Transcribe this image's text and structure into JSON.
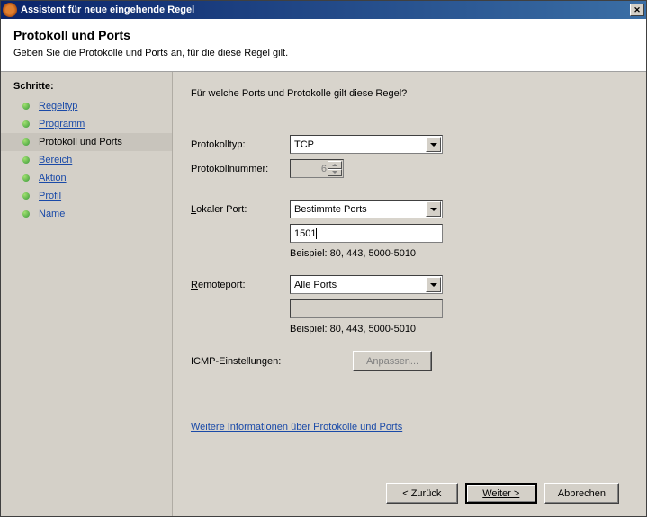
{
  "window": {
    "title": "Assistent für neue eingehende Regel"
  },
  "header": {
    "title": "Protokoll und Ports",
    "subtitle": "Geben Sie die Protokolle und Ports an, für die diese Regel gilt."
  },
  "sidebar": {
    "title": "Schritte:",
    "items": [
      {
        "label": "Regeltyp",
        "active": false
      },
      {
        "label": "Programm",
        "active": false
      },
      {
        "label": "Protokoll und Ports",
        "active": true
      },
      {
        "label": "Bereich",
        "active": false
      },
      {
        "label": "Aktion",
        "active": false
      },
      {
        "label": "Profil",
        "active": false
      },
      {
        "label": "Name",
        "active": false
      }
    ]
  },
  "content": {
    "question": "Für welche Ports und Protokolle gilt diese Regel?",
    "protocol_type_label": "Protokolltyp:",
    "protocol_type_value": "TCP",
    "protocol_number_label": "Protokollnummer:",
    "protocol_number_value": "6",
    "local_port_label_pre": "L",
    "local_port_label_post": "okaler Port:",
    "local_port_select": "Bestimmte Ports",
    "local_port_value": "1501",
    "local_port_example": "Beispiel: 80, 443, 5000-5010",
    "remote_port_label_pre": "R",
    "remote_port_label_post": "emoteport:",
    "remote_port_select": "Alle Ports",
    "remote_port_value": "",
    "remote_port_example": "Beispiel: 80, 443, 5000-5010",
    "icmp_label": "ICMP-Einstellungen:",
    "icmp_button": "Anpassen...",
    "more_info": "Weitere Informationen über Protokolle und Ports"
  },
  "buttons": {
    "back": "< Zurück",
    "next": "Weiter >",
    "cancel": "Abbrechen"
  }
}
